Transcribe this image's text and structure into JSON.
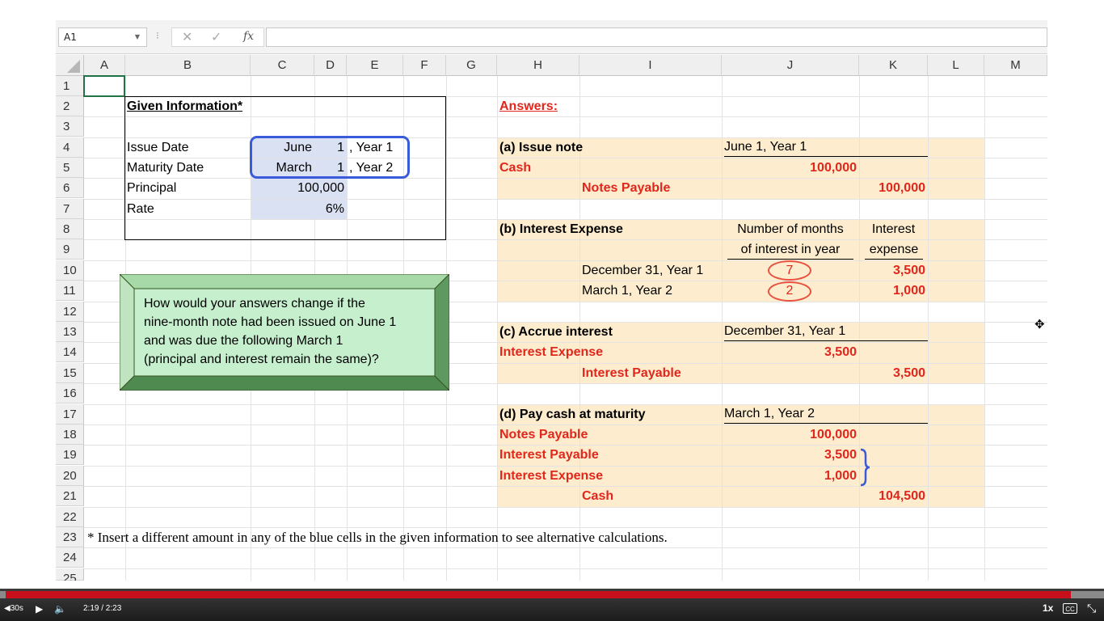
{
  "formula_bar": {
    "name_box": "A1",
    "separator": "⁝",
    "cancel_icon": "✕",
    "enter_icon": "✓",
    "fx_label": "fx",
    "formula": ""
  },
  "columns": [
    "A",
    "B",
    "C",
    "D",
    "E",
    "F",
    "G",
    "H",
    "I",
    "J",
    "K",
    "L",
    "M"
  ],
  "rows": [
    "1",
    "2",
    "3",
    "4",
    "5",
    "6",
    "7",
    "8",
    "9",
    "10",
    "11",
    "12",
    "13",
    "14",
    "15",
    "16",
    "17",
    "18",
    "19",
    "20",
    "21",
    "22",
    "23",
    "24",
    "25"
  ],
  "given": {
    "title": "Given Information*",
    "issue_label": "Issue Date",
    "issue_month": "June",
    "issue_day": "1",
    "issue_year": ", Year 1",
    "maturity_label": "Maturity Date",
    "maturity_month": "March",
    "maturity_day": "1",
    "maturity_year": ", Year 2",
    "principal_label": "Principal",
    "principal_value": "100,000",
    "rate_label": "Rate",
    "rate_value": "6%"
  },
  "question_box": {
    "line1": "How would your answers change if the",
    "line2": "nine-month note had been issued on June 1",
    "line3": "and was due the following March 1",
    "line4": "(principal and interest remain the same)?"
  },
  "answers": {
    "title": "Answers:",
    "a": {
      "label": "(a) Issue note",
      "date": "June 1, Year 1",
      "debit_account": "Cash",
      "debit_amount": "100,000",
      "credit_account": "Notes Payable",
      "credit_amount": "100,000"
    },
    "b": {
      "label": "(b) Interest Expense",
      "hdr_months_1": "Number of months",
      "hdr_months_2": "of interest in year",
      "hdr_interest_1": "Interest",
      "hdr_interest_2": "expense",
      "row1_label": "December 31, Year 1",
      "row1_months": "7",
      "row1_amount": "3,500",
      "row2_label": "March 1, Year 2",
      "row2_months": "2",
      "row2_amount": "1,000"
    },
    "c": {
      "label": "(c) Accrue interest",
      "date": "December 31, Year 1",
      "debit_account": "Interest Expense",
      "debit_amount": "3,500",
      "credit_account": "Interest Payable",
      "credit_amount": "3,500"
    },
    "d": {
      "label": "(d) Pay cash at maturity",
      "date": "March 1, Year 2",
      "debit1_account": "Notes Payable",
      "debit1_amount": "100,000",
      "debit2_account": "Interest Payable",
      "debit2_amount": "3,500",
      "debit3_account": "Interest Expense",
      "debit3_amount": "1,000",
      "credit_account": "Cash",
      "credit_amount": "104,500"
    }
  },
  "footnote": "* Insert a different amount in any of the blue cells in the given information to see alternative calculations.",
  "player": {
    "rewind_label": "30s",
    "time": "2:19 / 2:23",
    "progress": 0.97,
    "speed": "1x",
    "cc_label": "CC"
  },
  "colors": {
    "accent_red": "#e1261c",
    "answer_shade": "#fdedce",
    "input_blue": "#d9e1f2",
    "highlight_blue": "#3a5bd9",
    "question_green": "#c6efce",
    "progress_red": "#c7101c"
  }
}
